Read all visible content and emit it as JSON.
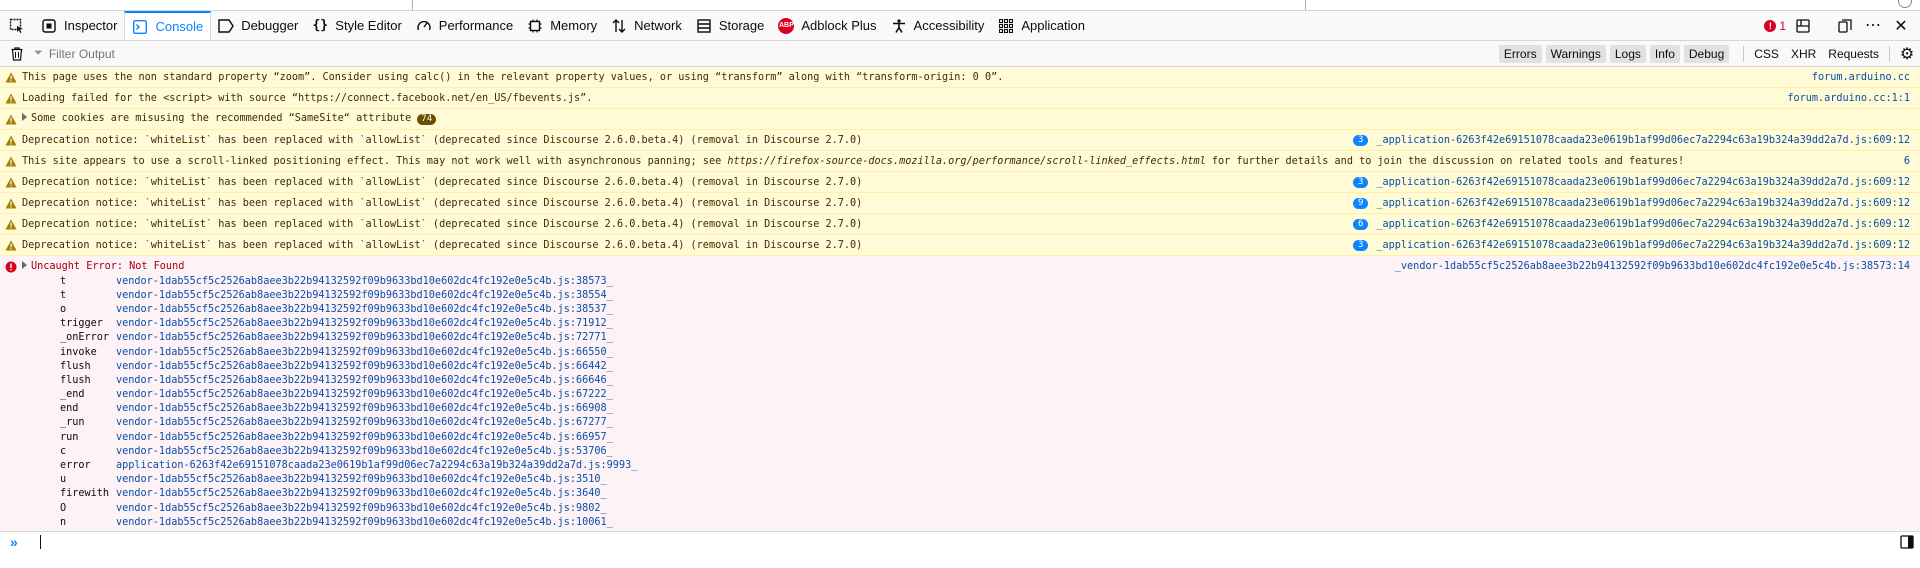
{
  "toolbar": {
    "tabs": [
      {
        "label": "Inspector",
        "icon": "inspector-icon"
      },
      {
        "label": "Console",
        "icon": "console-icon"
      },
      {
        "label": "Debugger",
        "icon": "debugger-icon"
      },
      {
        "label": "Style Editor",
        "icon": "style-editor-icon"
      },
      {
        "label": "Performance",
        "icon": "performance-icon"
      },
      {
        "label": "Memory",
        "icon": "memory-icon"
      },
      {
        "label": "Network",
        "icon": "network-icon"
      },
      {
        "label": "Storage",
        "icon": "storage-icon"
      },
      {
        "label": "Adblock Plus",
        "icon": "adblock-plus-icon"
      },
      {
        "label": "Accessibility",
        "icon": "accessibility-icon"
      },
      {
        "label": "Application",
        "icon": "application-icon"
      }
    ],
    "error_count": "1",
    "adblock_text": "ABP"
  },
  "filter": {
    "placeholder": "Filter Output",
    "levels": [
      "Errors",
      "Warnings",
      "Logs",
      "Info",
      "Debug"
    ],
    "types": [
      "CSS",
      "XHR",
      "Requests"
    ]
  },
  "messages": [
    {
      "text": "This page uses the non standard property “zoom”. Consider using calc() in the relevant property values, or using “transform” along with “transform-origin: 0 0”.",
      "loc": "forum.arduino.cc",
      "repeat": ""
    },
    {
      "text": "Loading failed for the <script> with source “https://connect.facebook.net/en_US/fbevents.js”.",
      "loc": "forum.arduino.cc:1:1",
      "repeat": ""
    },
    {
      "text": "Some cookies are misusing the recommended “SameSite“ attribute",
      "loc": "",
      "repeat": "",
      "count": "74"
    },
    {
      "text": "Deprecation notice: `whiteList` has been replaced with `allowList` (deprecated since Discourse 2.6.0.beta.4) (removal in Discourse 2.7.0)",
      "loc": "_application-6263f42e69151078caada23e0619b1af99d06ec7a2294c63a19b324a39dd2a7d.js:609:12",
      "repeat": "3"
    },
    {
      "text": "This site appears to use a scroll-linked positioning effect. This may not work well with asynchronous panning; see ",
      "link": "https://firefox-source-docs.mozilla.org/performance/scroll-linked_effects.html",
      "after": " for further details and to join the discussion on related tools and features!",
      "loc": "6",
      "repeat": ""
    },
    {
      "text": "Deprecation notice: `whiteList` has been replaced with `allowList` (deprecated since Discourse 2.6.0.beta.4) (removal in Discourse 2.7.0)",
      "loc": "_application-6263f42e69151078caada23e0619b1af99d06ec7a2294c63a19b324a39dd2a7d.js:609:12",
      "repeat": "3"
    },
    {
      "text": "Deprecation notice: `whiteList` has been replaced with `allowList` (deprecated since Discourse 2.6.0.beta.4) (removal in Discourse 2.7.0)",
      "loc": "_application-6263f42e69151078caada23e0619b1af99d06ec7a2294c63a19b324a39dd2a7d.js:609:12",
      "repeat": "9"
    },
    {
      "text": "Deprecation notice: `whiteList` has been replaced with `allowList` (deprecated since Discourse 2.6.0.beta.4) (removal in Discourse 2.7.0)",
      "loc": "_application-6263f42e69151078caada23e0619b1af99d06ec7a2294c63a19b324a39dd2a7d.js:609:12",
      "repeat": "6"
    },
    {
      "text": "Deprecation notice: `whiteList` has been replaced with `allowList` (deprecated since Discourse 2.6.0.beta.4) (removal in Discourse 2.7.0)",
      "loc": "_application-6263f42e69151078caada23e0619b1af99d06ec7a2294c63a19b324a39dd2a7d.js:609:12",
      "repeat": "3"
    }
  ],
  "error": {
    "title": "Uncaught Error: Not Found",
    "loc": "_vendor-1dab55cf5c2526ab8aee3b22b94132592f09b9633bd10e602dc4fc192e0e5c4b.js:38573:14",
    "frames": [
      {
        "fn": "t",
        "src": "vendor-1dab55cf5c2526ab8aee3b22b94132592f09b9633bd10e602dc4fc192e0e5c4b.js:38573_"
      },
      {
        "fn": "t",
        "src": "vendor-1dab55cf5c2526ab8aee3b22b94132592f09b9633bd10e602dc4fc192e0e5c4b.js:38554_"
      },
      {
        "fn": "o",
        "src": "vendor-1dab55cf5c2526ab8aee3b22b94132592f09b9633bd10e602dc4fc192e0e5c4b.js:38537_"
      },
      {
        "fn": "trigger",
        "src": "vendor-1dab55cf5c2526ab8aee3b22b94132592f09b9633bd10e602dc4fc192e0e5c4b.js:71912_"
      },
      {
        "fn": "_onError",
        "src": "vendor-1dab55cf5c2526ab8aee3b22b94132592f09b9633bd10e602dc4fc192e0e5c4b.js:72771_"
      },
      {
        "fn": "invoke",
        "src": "vendor-1dab55cf5c2526ab8aee3b22b94132592f09b9633bd10e602dc4fc192e0e5c4b.js:66550_"
      },
      {
        "fn": "flush",
        "src": "vendor-1dab55cf5c2526ab8aee3b22b94132592f09b9633bd10e602dc4fc192e0e5c4b.js:66442_"
      },
      {
        "fn": "flush",
        "src": "vendor-1dab55cf5c2526ab8aee3b22b94132592f09b9633bd10e602dc4fc192e0e5c4b.js:66646_"
      },
      {
        "fn": "_end",
        "src": "vendor-1dab55cf5c2526ab8aee3b22b94132592f09b9633bd10e602dc4fc192e0e5c4b.js:67222_"
      },
      {
        "fn": "end",
        "src": "vendor-1dab55cf5c2526ab8aee3b22b94132592f09b9633bd10e602dc4fc192e0e5c4b.js:66908_"
      },
      {
        "fn": "_run",
        "src": "vendor-1dab55cf5c2526ab8aee3b22b94132592f09b9633bd10e602dc4fc192e0e5c4b.js:67277_"
      },
      {
        "fn": "run",
        "src": "vendor-1dab55cf5c2526ab8aee3b22b94132592f09b9633bd10e602dc4fc192e0e5c4b.js:66957_"
      },
      {
        "fn": "c",
        "src": "vendor-1dab55cf5c2526ab8aee3b22b94132592f09b9633bd10e602dc4fc192e0e5c4b.js:53706_"
      },
      {
        "fn": "error",
        "src": "application-6263f42e69151078caada23e0619b1af99d06ec7a2294c63a19b324a39dd2a7d.js:9993_"
      },
      {
        "fn": "u",
        "src": "vendor-1dab55cf5c2526ab8aee3b22b94132592f09b9633bd10e602dc4fc192e0e5c4b.js:3510_"
      },
      {
        "fn": "firewith",
        "src": "vendor-1dab55cf5c2526ab8aee3b22b94132592f09b9633bd10e602dc4fc192e0e5c4b.js:3640_"
      },
      {
        "fn": "O",
        "src": "vendor-1dab55cf5c2526ab8aee3b22b94132592f09b9633bd10e602dc4fc192e0e5c4b.js:9802_"
      },
      {
        "fn": "n",
        "src": "vendor-1dab55cf5c2526ab8aee3b22b94132592f09b9633bd10e602dc4fc192e0e5c4b.js:10061_"
      }
    ]
  },
  "console_input": {
    "prompt": "»",
    "value": ""
  },
  "colors": {
    "accent": "#0a84ff",
    "warning_bg": "#fffbd6",
    "error_bg": "#fdf2f5",
    "error": "#d70022"
  }
}
